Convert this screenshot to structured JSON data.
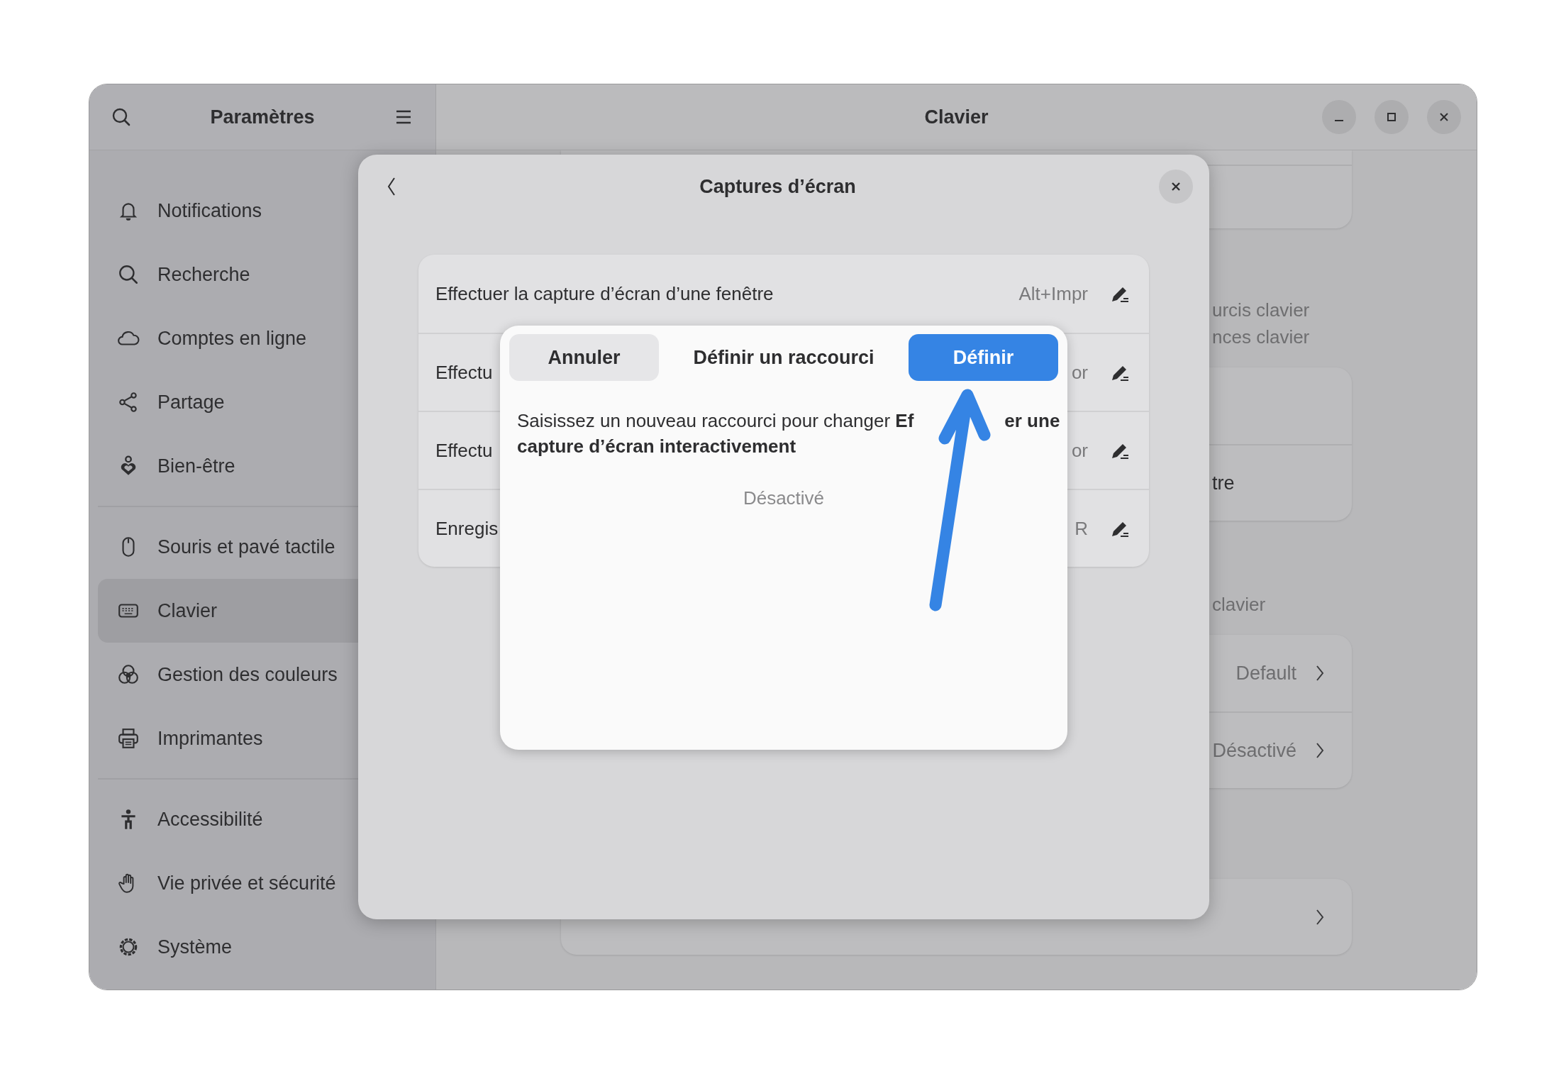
{
  "window": {
    "sidebar_title": "Paramètres",
    "title": "Clavier"
  },
  "sidebar": {
    "groups": [
      {
        "items": [
          {
            "label": "Notifications",
            "selected": false
          },
          {
            "label": "Recherche",
            "selected": false
          },
          {
            "label": "Comptes en ligne",
            "selected": false
          },
          {
            "label": "Partage",
            "selected": false
          },
          {
            "label": "Bien-être",
            "selected": false
          }
        ]
      },
      {
        "items": [
          {
            "label": "Souris et pavé tactile",
            "selected": false
          },
          {
            "label": "Clavier",
            "selected": true
          },
          {
            "label": "Gestion des couleurs",
            "selected": false
          },
          {
            "label": "Imprimantes",
            "selected": false
          }
        ]
      },
      {
        "items": [
          {
            "label": "Accessibilité",
            "selected": false
          },
          {
            "label": "Vie privée et sécurité",
            "selected": false
          },
          {
            "label": "Système",
            "selected": false
          }
        ]
      }
    ]
  },
  "main": {
    "label_lines": [
      "urcis clavier",
      "nces clavier"
    ],
    "card_1": {
      "rows": [
        {
          "label": "tre"
        }
      ]
    },
    "section_label": "clavier",
    "card_2": {
      "rows": [
        {
          "value": "Default"
        },
        {
          "value": "Désactivé"
        }
      ]
    }
  },
  "dialog": {
    "title": "Captures d’écran",
    "rows": [
      {
        "label": "Effectuer la capture d’écran d’une fenêtre",
        "shortcut": "Alt+Impr"
      },
      {
        "label": "Effectu",
        "shortcut": "or"
      },
      {
        "label": "Effectu",
        "shortcut": "or"
      },
      {
        "label": "Enregis",
        "shortcut": "R"
      }
    ]
  },
  "shortcut_dialog": {
    "cancel": "Annuler",
    "title": "Définir un raccourci",
    "confirm": "Définir",
    "message_line_1": [
      "Saisissez un nouveau raccourci pour changer **Ef**",
      "er une"
    ],
    "message_line_2": "capture d’écran interactivement",
    "status": "Désactivé"
  }
}
